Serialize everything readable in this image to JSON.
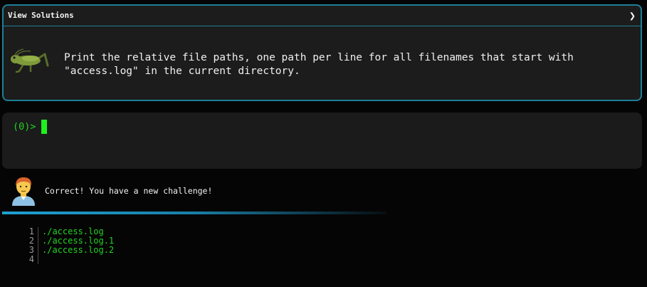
{
  "challenge": {
    "header_title": "View Solutions",
    "expand_icon": "chevron-right-icon",
    "mascot_icon": "grasshopper-icon",
    "prompt": "Print the relative file paths, one path per line for all filenames that start with\n\"access.log\" in the current directory."
  },
  "terminal": {
    "prompt": "(0)>"
  },
  "feedback": {
    "avatar_icon": "person-avatar-icon",
    "message": "Correct! You have a new challenge!"
  },
  "output": {
    "lines": [
      {
        "num": "1",
        "text": "./access.log"
      },
      {
        "num": "2",
        "text": "./access.log.1"
      },
      {
        "num": "3",
        "text": "./access.log.2"
      },
      {
        "num": "4",
        "text": ""
      }
    ]
  },
  "colors": {
    "accent_border": "#1e7f97",
    "terminal_green": "#1ff01f",
    "panel_bg": "#1c1c1c",
    "page_bg": "#050505"
  }
}
